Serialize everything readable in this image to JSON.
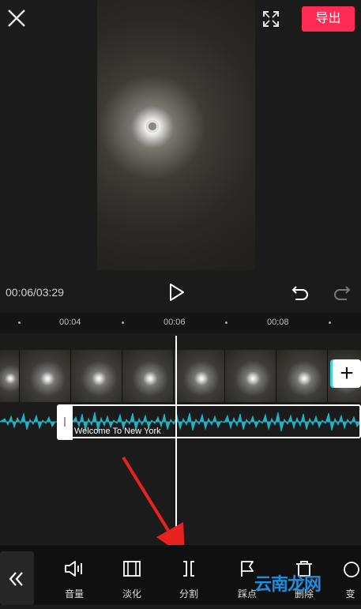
{
  "header": {
    "export_label": "导出"
  },
  "player": {
    "time": "00:06/03:29"
  },
  "ruler": {
    "labels": [
      "00:04",
      "00:06",
      "00:08"
    ]
  },
  "audio": {
    "clip_title": "Welcome To New York"
  },
  "toolbar": {
    "items": [
      {
        "label": "音量",
        "icon": "volume-icon"
      },
      {
        "label": "淡化",
        "icon": "fade-icon"
      },
      {
        "label": "分割",
        "icon": "split-icon"
      },
      {
        "label": "踩点",
        "icon": "beat-flag-icon"
      },
      {
        "label": "删除",
        "icon": "delete-icon"
      },
      {
        "label": "变",
        "icon": "speed-icon"
      }
    ]
  },
  "watermark": {
    "text": "云南龙网"
  },
  "colors": {
    "accent": "#fe2c55",
    "waveform": "#1fb3c4",
    "cyan_edge": "#3ad6e0"
  }
}
